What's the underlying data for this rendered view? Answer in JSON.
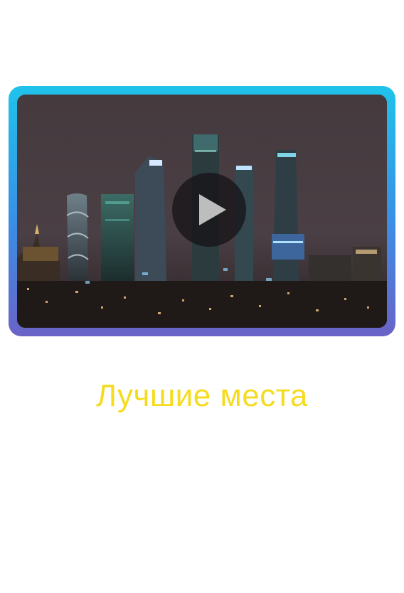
{
  "video": {
    "thumbnail_alt": "",
    "play_icon": "play-icon",
    "border_gradient": [
      "#1fc3ea",
      "#3a8ee6",
      "#6a63c6"
    ]
  },
  "caption": {
    "text": "Лучшие места",
    "color": "#f5dc1f"
  }
}
